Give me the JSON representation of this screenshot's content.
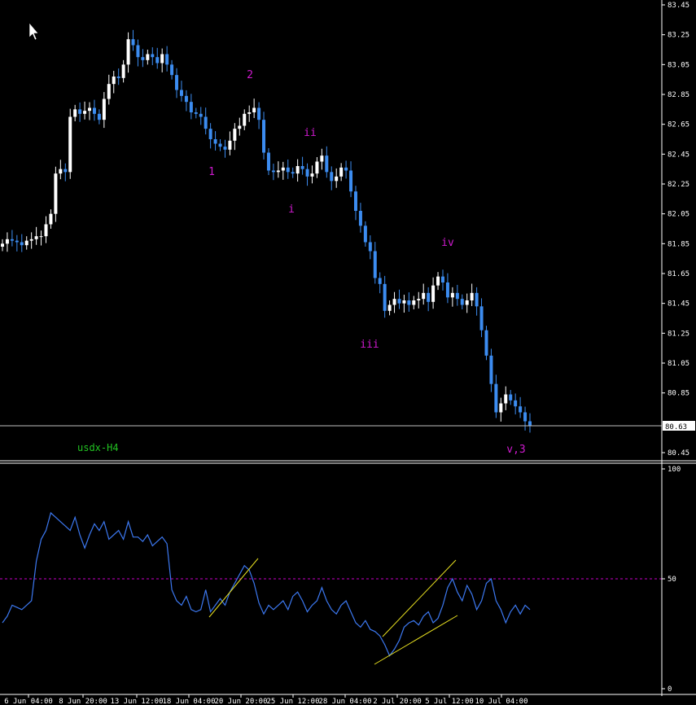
{
  "window": {
    "symbol_label": "usdx-H4"
  },
  "colors": {
    "background": "#000000",
    "axis": "#ffffff",
    "bull_candle": "#ffffff",
    "bear_candle": "#3c8cf0",
    "wave_label": "#d01ad0",
    "symbol_label": "#22c322",
    "rsi_line": "#3c78f0",
    "trendline": "#e8e020",
    "level_line": "#c800c8",
    "price_line": "#c0c0c0"
  },
  "chart_data": [
    {
      "type": "candlestick",
      "title": "usdx-H4",
      "y_ticks": [
        "83.45",
        "83.25",
        "83.05",
        "82.85",
        "82.65",
        "82.45",
        "82.25",
        "82.05",
        "81.85",
        "81.65",
        "81.45",
        "81.25",
        "81.05",
        "80.85",
        "80.45"
      ],
      "ylim": [
        80.42,
        83.47
      ],
      "current_price": "80.63",
      "wave_labels": [
        {
          "text": "2",
          "x": "16 Jun 12:00",
          "y": 83.02
        },
        {
          "text": "1",
          "x": "18 Jun 08:00",
          "y": 82.3
        },
        {
          "text": "ii",
          "x": "25 Jun 00:00",
          "y": 82.53
        },
        {
          "text": "i",
          "x": "24 Jun 20:00",
          "y": 81.97
        },
        {
          "text": "iv",
          "x": "5 Jul 04:00",
          "y": 81.8
        },
        {
          "text": "iii",
          "x": "1 Jul 20:00",
          "y": 81.14
        },
        {
          "text": "v,3",
          "x": "10 Jul 16:00",
          "y": 80.45
        }
      ],
      "close_series": [
        81.85,
        81.88,
        81.87,
        81.86,
        81.84,
        81.87,
        81.88,
        81.9,
        81.9,
        81.98,
        82.05,
        82.32,
        82.35,
        82.33,
        82.7,
        82.75,
        82.72,
        82.74,
        82.76,
        82.72,
        82.68,
        82.82,
        82.92,
        82.97,
        82.96,
        83.05,
        83.22,
        83.18,
        83.1,
        83.08,
        83.12,
        83.1,
        83.06,
        83.12,
        83.05,
        82.98,
        82.88,
        82.84,
        82.8,
        82.73,
        82.72,
        82.7,
        82.62,
        82.55,
        82.52,
        82.5,
        82.48,
        82.54,
        82.62,
        82.64,
        82.72,
        82.73,
        82.76,
        82.68,
        82.46,
        82.34,
        82.33,
        82.34,
        82.36,
        82.33,
        82.32,
        82.37,
        82.35,
        82.3,
        82.32,
        82.4,
        82.44,
        82.33,
        82.27,
        82.3,
        82.36,
        82.34,
        82.2,
        82.07,
        81.97,
        81.86,
        81.8,
        81.62,
        81.58,
        81.4,
        81.44,
        81.48,
        81.45,
        81.47,
        81.44,
        81.47,
        81.48,
        81.52,
        81.46,
        81.57,
        81.63,
        81.59,
        81.49,
        81.52,
        81.48,
        81.44,
        81.47,
        81.52,
        81.43,
        81.27,
        81.1,
        80.91,
        80.72,
        80.78,
        80.84,
        80.8,
        80.76,
        80.72,
        80.66,
        80.63
      ],
      "series": [
        {
          "name": "RSI",
          "values": [
            30,
            33,
            38,
            37,
            36,
            38,
            40,
            58,
            68,
            72,
            80,
            78,
            76,
            74,
            72,
            78,
            70,
            64,
            70,
            75,
            72,
            76,
            68,
            70,
            72,
            68,
            76,
            69,
            69,
            67,
            70,
            65,
            67,
            69,
            66,
            45,
            40,
            38,
            42,
            36,
            35,
            36,
            45,
            35,
            38,
            41,
            38,
            44,
            48,
            52,
            56,
            54,
            48,
            39,
            34,
            38,
            36,
            38,
            40,
            36,
            42,
            44,
            40,
            35,
            38,
            40,
            46,
            40,
            36,
            34,
            38,
            40,
            35,
            30,
            28,
            31,
            27,
            26,
            24,
            20,
            15,
            18,
            22,
            28,
            30,
            31,
            29,
            33,
            35,
            30,
            32,
            38,
            46,
            50,
            44,
            40,
            47,
            43,
            36,
            40,
            48,
            50,
            40,
            36,
            30,
            35,
            38,
            34,
            38,
            36
          ]
        },
        {
          "name": "trendlines",
          "values": []
        }
      ],
      "level": 50,
      "y_ticks_sub": [
        "100",
        "50",
        "0"
      ],
      "x_tick_labels": [
        "6 Jun 04:00",
        "8 Jun 20:00",
        "13 Jun 12:00",
        "18 Jun 04:00",
        "20 Jun 20:00",
        "25 Jun 12:00",
        "28 Jun 04:00",
        "2 Jul 20:00",
        "5 Jul 12:00",
        "10 Jul 04:00"
      ]
    }
  ]
}
